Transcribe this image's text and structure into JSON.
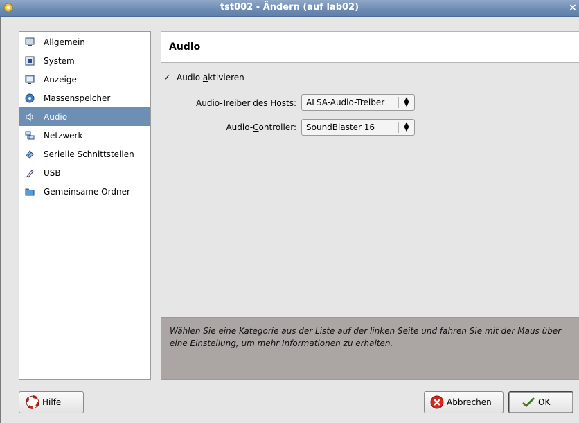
{
  "window": {
    "title": "tst002 - Ändern (auf lab02)",
    "close_glyph": "×"
  },
  "sidebar": {
    "items": [
      {
        "label": "Allgemein",
        "icon": "monitor-icon"
      },
      {
        "label": "System",
        "icon": "chip-icon"
      },
      {
        "label": "Anzeige",
        "icon": "display-icon"
      },
      {
        "label": "Massenspeicher",
        "icon": "disk-icon"
      },
      {
        "label": "Audio",
        "icon": "speaker-icon",
        "selected": true
      },
      {
        "label": "Netzwerk",
        "icon": "network-icon"
      },
      {
        "label": "Serielle Schnittstellen",
        "icon": "serial-icon"
      },
      {
        "label": "USB",
        "icon": "usb-icon"
      },
      {
        "label": "Gemeinsame Ordner",
        "icon": "folder-icon"
      }
    ]
  },
  "content": {
    "header": "Audio",
    "enable_audio": {
      "label_pre": "Audio ",
      "label_mn": "a",
      "label_post": "ktivieren",
      "checked": true,
      "check_glyph": "✓"
    },
    "driver": {
      "label_pre": "Audio-",
      "label_mn": "T",
      "label_post": "reiber des Hosts:",
      "value": "ALSA-Audio-Treiber"
    },
    "controller": {
      "label_pre": "Audio-",
      "label_mn": "C",
      "label_post": "ontroller:",
      "value": "SoundBlaster 16"
    },
    "info": "Wählen Sie eine Kategorie aus der Liste auf der linken Seite und fahren Sie mit der Maus über eine Einstellung, um mehr Informationen zu erhalten."
  },
  "buttons": {
    "help": {
      "mn": "H",
      "rest": "ilfe"
    },
    "cancel": {
      "label": "Abbrechen"
    },
    "ok": {
      "mn": "O",
      "rest": "K"
    }
  },
  "colors": {
    "selection": "#6d8fb4",
    "titlebar": "#6d8bb3",
    "info_bg": "#aba6a3"
  }
}
